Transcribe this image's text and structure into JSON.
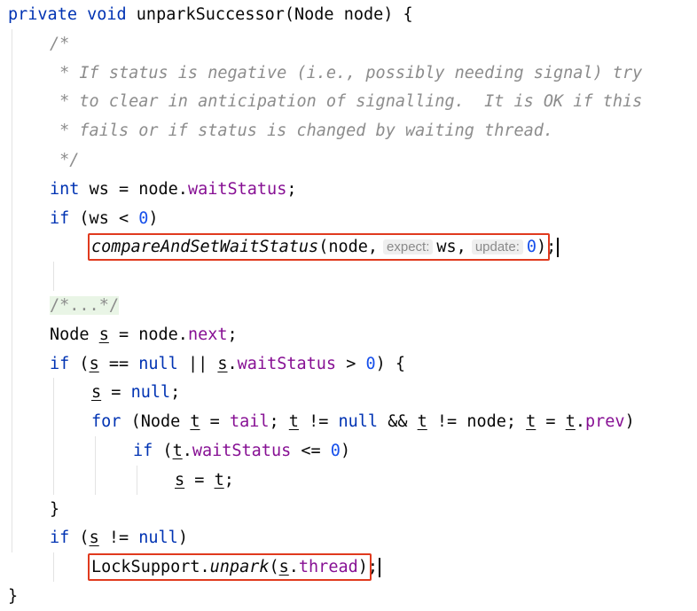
{
  "editor": {
    "lines": [
      {
        "indent": 0,
        "tokens": [
          {
            "t": "private void ",
            "c": "kw"
          },
          {
            "t": "unparkSuccessor",
            "c": "plain"
          },
          {
            "t": "(Node node) {",
            "c": "plain"
          }
        ]
      },
      {
        "indent": 1,
        "tokens": [
          {
            "t": "/*",
            "c": "comment"
          }
        ]
      },
      {
        "indent": 1,
        "tokens": [
          {
            "t": " * If status is negative (i.e., possibly needing signal) try",
            "c": "comment"
          }
        ]
      },
      {
        "indent": 1,
        "tokens": [
          {
            "t": " * to clear in anticipation of signalling.  It is OK if this",
            "c": "comment"
          }
        ]
      },
      {
        "indent": 1,
        "tokens": [
          {
            "t": " * fails or if status is changed by waiting thread.",
            "c": "comment"
          }
        ]
      },
      {
        "indent": 1,
        "tokens": [
          {
            "t": " */",
            "c": "comment"
          }
        ]
      },
      {
        "indent": 1,
        "tokens": [
          {
            "t": "int ",
            "c": "kw"
          },
          {
            "t": "ws = node.",
            "c": "plain"
          },
          {
            "t": "waitStatus",
            "c": "field"
          },
          {
            "t": ";",
            "c": "plain"
          }
        ]
      },
      {
        "indent": 1,
        "tokens": [
          {
            "t": "if ",
            "c": "kw"
          },
          {
            "t": "(ws < ",
            "c": "plain"
          },
          {
            "t": "0",
            "c": "num"
          },
          {
            "t": ")",
            "c": "plain"
          }
        ]
      },
      {
        "indent": 2,
        "tokens": [
          {
            "t": "compareAndSetWaitStatus",
            "c": "italic"
          },
          {
            "t": "(node,",
            "c": "plain"
          },
          {
            "t": "expect:",
            "c": "hint"
          },
          {
            "t": "ws,",
            "c": "plain"
          },
          {
            "t": "update:",
            "c": "hint"
          },
          {
            "t": "0",
            "c": "num"
          },
          {
            "t": ")",
            "c": "plain"
          },
          {
            "t": ";",
            "c": "plain"
          },
          {
            "t": "",
            "c": "caret"
          }
        ]
      },
      {
        "indent": 0,
        "tokens": []
      },
      {
        "indent": 1,
        "tokens": [
          {
            "t": "/*...*/",
            "c": "fold"
          }
        ]
      },
      {
        "indent": 1,
        "tokens": [
          {
            "t": "Node ",
            "c": "plain"
          },
          {
            "t": "s",
            "c": "plain",
            "u": true
          },
          {
            "t": " = node.",
            "c": "plain"
          },
          {
            "t": "next",
            "c": "field"
          },
          {
            "t": ";",
            "c": "plain"
          }
        ]
      },
      {
        "indent": 1,
        "tokens": [
          {
            "t": "if ",
            "c": "kw"
          },
          {
            "t": "(",
            "c": "plain"
          },
          {
            "t": "s",
            "c": "plain",
            "u": true
          },
          {
            "t": " == ",
            "c": "plain"
          },
          {
            "t": "null",
            "c": "kw"
          },
          {
            "t": " || ",
            "c": "plain"
          },
          {
            "t": "s",
            "c": "plain",
            "u": true
          },
          {
            "t": ".",
            "c": "plain"
          },
          {
            "t": "waitStatus",
            "c": "field"
          },
          {
            "t": " > ",
            "c": "plain"
          },
          {
            "t": "0",
            "c": "num"
          },
          {
            "t": ") {",
            "c": "plain"
          }
        ]
      },
      {
        "indent": 2,
        "tokens": [
          {
            "t": "s",
            "c": "plain",
            "u": true
          },
          {
            "t": " = ",
            "c": "plain"
          },
          {
            "t": "null",
            "c": "kw"
          },
          {
            "t": ";",
            "c": "plain"
          }
        ]
      },
      {
        "indent": 2,
        "tokens": [
          {
            "t": "for ",
            "c": "kw"
          },
          {
            "t": "(Node ",
            "c": "plain"
          },
          {
            "t": "t",
            "c": "plain",
            "u": true
          },
          {
            "t": " = ",
            "c": "plain"
          },
          {
            "t": "tail",
            "c": "field"
          },
          {
            "t": "; ",
            "c": "plain"
          },
          {
            "t": "t",
            "c": "plain",
            "u": true
          },
          {
            "t": " != ",
            "c": "plain"
          },
          {
            "t": "null",
            "c": "kw"
          },
          {
            "t": " && ",
            "c": "plain"
          },
          {
            "t": "t",
            "c": "plain",
            "u": true
          },
          {
            "t": " != node; ",
            "c": "plain"
          },
          {
            "t": "t",
            "c": "plain",
            "u": true
          },
          {
            "t": " = ",
            "c": "plain"
          },
          {
            "t": "t",
            "c": "plain",
            "u": true
          },
          {
            "t": ".",
            "c": "plain"
          },
          {
            "t": "prev",
            "c": "field"
          },
          {
            "t": ")",
            "c": "plain"
          }
        ]
      },
      {
        "indent": 3,
        "tokens": [
          {
            "t": "if ",
            "c": "kw"
          },
          {
            "t": "(",
            "c": "plain"
          },
          {
            "t": "t",
            "c": "plain",
            "u": true
          },
          {
            "t": ".",
            "c": "plain"
          },
          {
            "t": "waitStatus",
            "c": "field"
          },
          {
            "t": " <= ",
            "c": "plain"
          },
          {
            "t": "0",
            "c": "num"
          },
          {
            "t": ")",
            "c": "plain"
          }
        ]
      },
      {
        "indent": 4,
        "tokens": [
          {
            "t": "s",
            "c": "plain",
            "u": true
          },
          {
            "t": " = ",
            "c": "plain"
          },
          {
            "t": "t",
            "c": "plain",
            "u": true
          },
          {
            "t": ";",
            "c": "plain"
          }
        ]
      },
      {
        "indent": 1,
        "tokens": [
          {
            "t": "}",
            "c": "plain"
          }
        ]
      },
      {
        "indent": 1,
        "tokens": [
          {
            "t": "if ",
            "c": "kw"
          },
          {
            "t": "(",
            "c": "plain"
          },
          {
            "t": "s",
            "c": "plain",
            "u": true
          },
          {
            "t": " != ",
            "c": "plain"
          },
          {
            "t": "null",
            "c": "kw"
          },
          {
            "t": ")",
            "c": "plain"
          }
        ]
      },
      {
        "indent": 2,
        "tokens": [
          {
            "t": "LockSupport.",
            "c": "plain"
          },
          {
            "t": "unpark",
            "c": "italic"
          },
          {
            "t": "(",
            "c": "plain"
          },
          {
            "t": "s",
            "c": "plain",
            "u": true
          },
          {
            "t": ".",
            "c": "plain"
          },
          {
            "t": "thread",
            "c": "field"
          },
          {
            "t": ")",
            "c": "plain"
          },
          {
            "t": ";",
            "c": "plain"
          },
          {
            "t": "",
            "c": "caret"
          }
        ]
      },
      {
        "indent": 0,
        "tokens": [
          {
            "t": "}",
            "c": "plain"
          }
        ]
      }
    ]
  },
  "colors": {
    "keyword": "#0033b3",
    "field": "#871094",
    "number": "#1750eb",
    "comment": "#8c8c8c",
    "highlight_box": "#e03a1e"
  }
}
